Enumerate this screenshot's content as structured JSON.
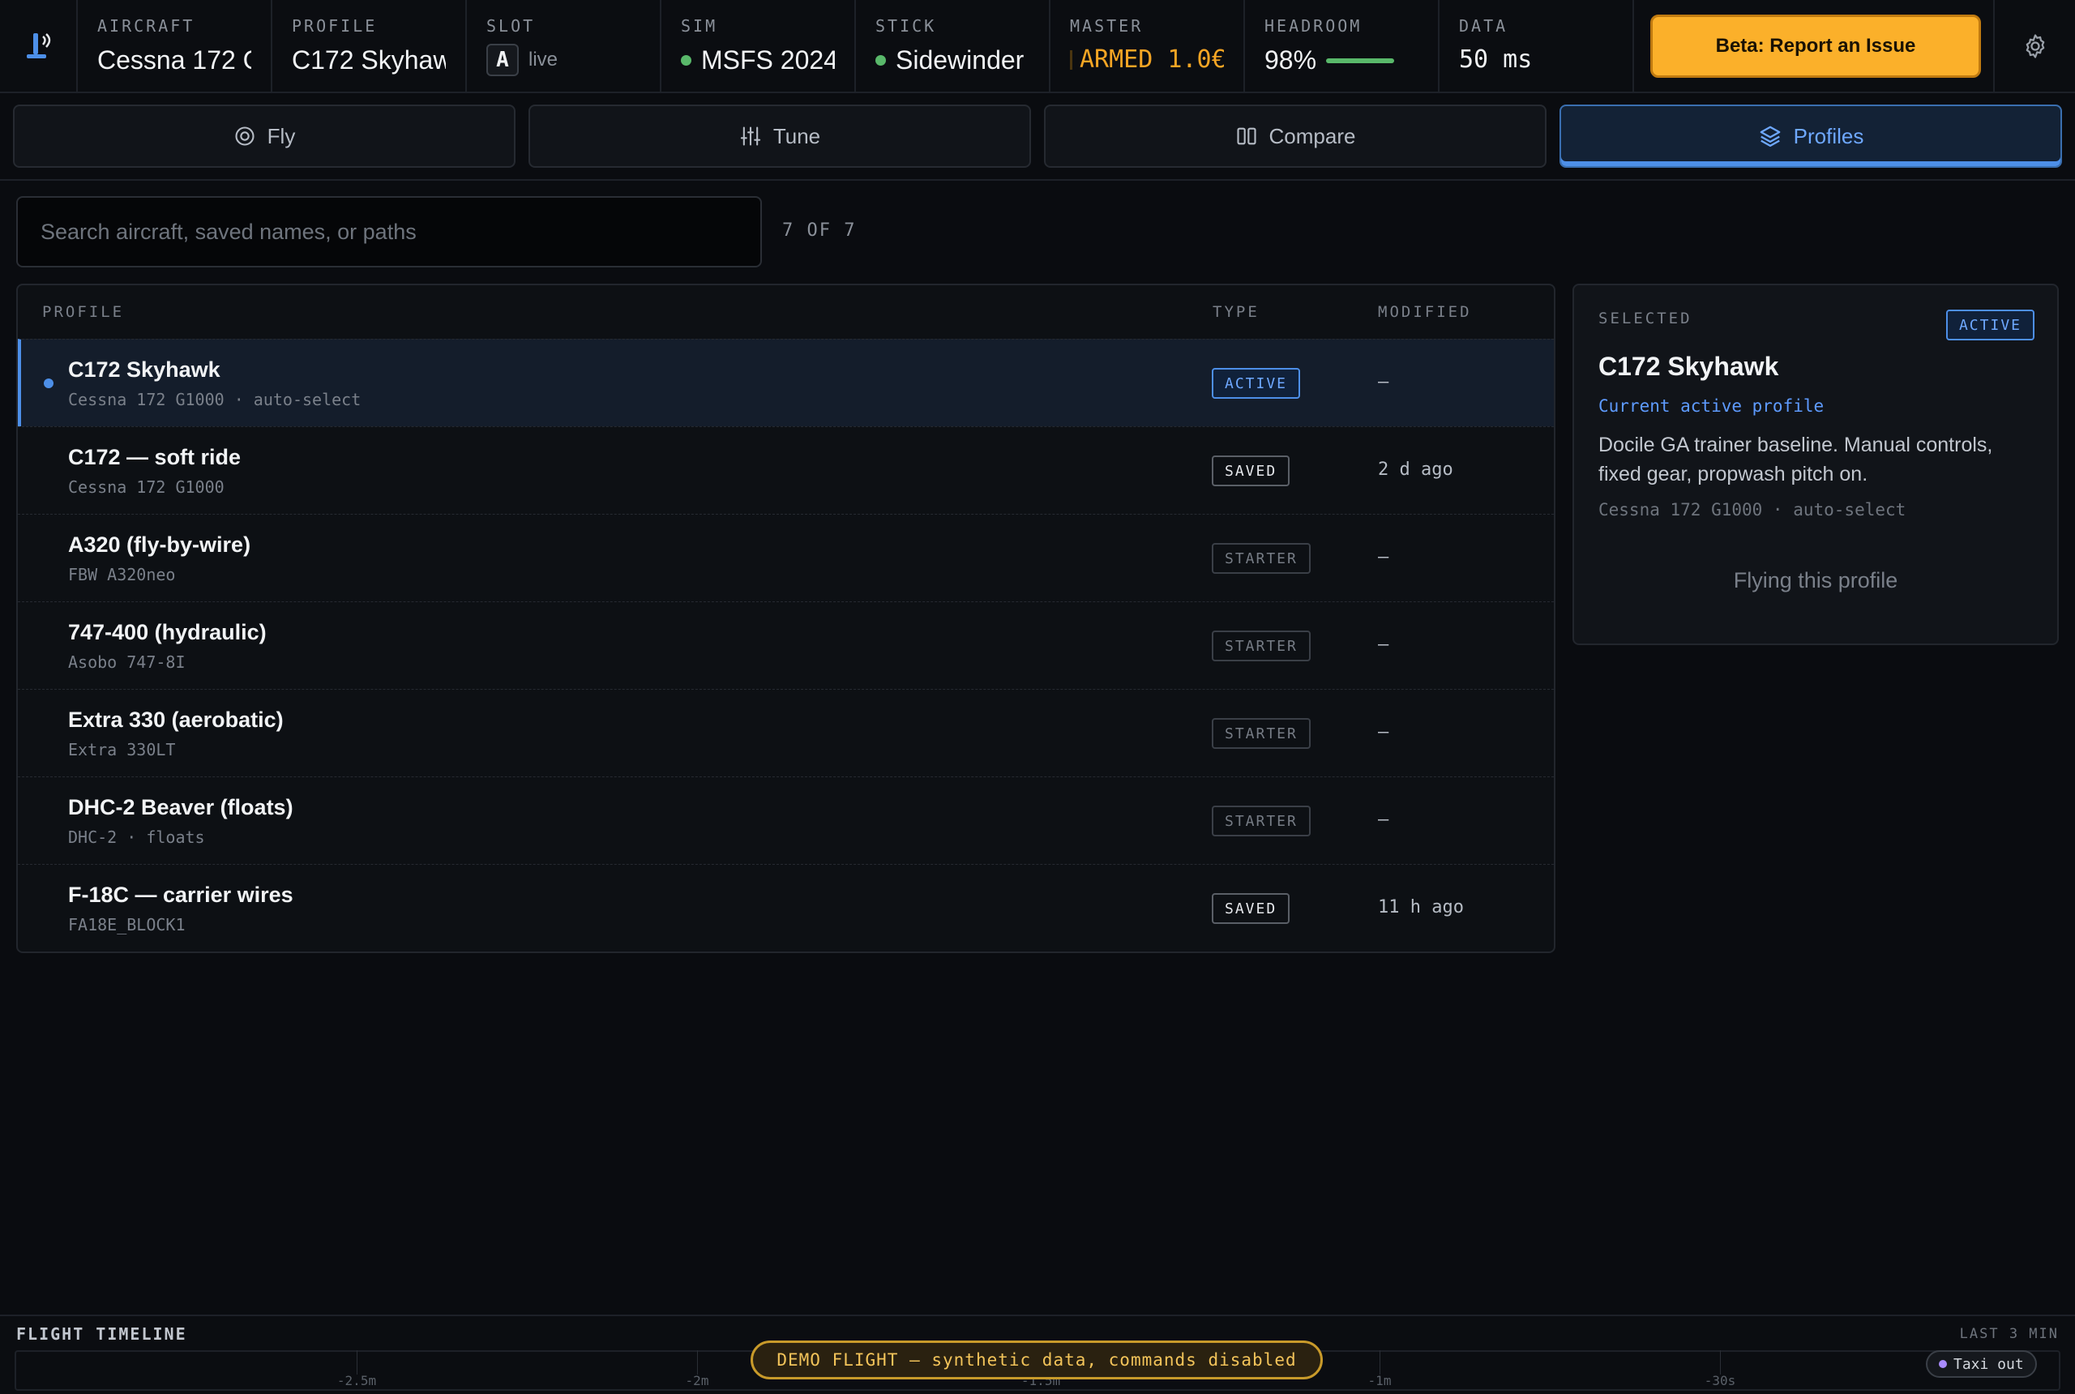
{
  "statusbar": {
    "aircraft": {
      "label": "AIRCRAFT",
      "value": "Cessna 172 G"
    },
    "profile": {
      "label": "PROFILE",
      "value": "C172 Skyhaw"
    },
    "slot": {
      "label": "SLOT",
      "value": "A",
      "state": "live"
    },
    "sim": {
      "label": "SIM",
      "value": "MSFS 2024",
      "status_color": "#59b86a"
    },
    "stick": {
      "label": "STICK",
      "value": "Sidewinder",
      "status_color": "#59b86a"
    },
    "master": {
      "label": "MASTER",
      "value": "ARMED 1.0€",
      "color": "#f5a524"
    },
    "headroom": {
      "label": "HEADROOM",
      "value": "98%",
      "level": 0.98
    },
    "data": {
      "label": "DATA",
      "value": "50 ms"
    },
    "report_button": "Beta: Report an Issue",
    "icons": {
      "logo": "app-logo-icon",
      "settings": "gear-icon"
    }
  },
  "tabs": [
    {
      "label": "Fly",
      "icon": "target-icon",
      "active": false
    },
    {
      "label": "Tune",
      "icon": "sliders-icon",
      "active": false
    },
    {
      "label": "Compare",
      "icon": "columns-icon",
      "active": false
    },
    {
      "label": "Profiles",
      "icon": "layers-icon",
      "active": true
    }
  ],
  "search": {
    "placeholder": "Search aircraft, saved names, or paths",
    "value": "",
    "count": "7 OF 7"
  },
  "table": {
    "headers": {
      "profile": "PROFILE",
      "type": "TYPE",
      "modified": "MODIFIED"
    },
    "rows": [
      {
        "name": "C172 Skyhawk",
        "sub": "Cessna 172 G1000 · auto-select",
        "type": "ACTIVE",
        "modified": "—",
        "selected": true
      },
      {
        "name": "C172 — soft ride",
        "sub": "Cessna 172 G1000",
        "type": "SAVED",
        "modified": "2 d ago",
        "selected": false
      },
      {
        "name": "A320 (fly-by-wire)",
        "sub": "FBW A320neo",
        "type": "STARTER",
        "modified": "—",
        "selected": false
      },
      {
        "name": "747-400 (hydraulic)",
        "sub": "Asobo 747-8I",
        "type": "STARTER",
        "modified": "—",
        "selected": false
      },
      {
        "name": "Extra 330 (aerobatic)",
        "sub": "Extra 330LT",
        "type": "STARTER",
        "modified": "—",
        "selected": false
      },
      {
        "name": "DHC-2 Beaver (floats)",
        "sub": "DHC-2 · floats",
        "type": "STARTER",
        "modified": "—",
        "selected": false
      },
      {
        "name": "F-18C — carrier wires",
        "sub": "FA18E_BLOCK1",
        "type": "SAVED",
        "modified": "11 h ago",
        "selected": false
      }
    ]
  },
  "selected_panel": {
    "label": "SELECTED",
    "badge": "ACTIVE",
    "title": "C172 Skyhawk",
    "status": "Current active profile",
    "description": "Docile GA trainer baseline. Manual controls, fixed gear, propwash pitch on.",
    "path": "Cessna 172 G1000 · auto-select",
    "cta": "Flying this profile"
  },
  "timeline": {
    "title": "FLIGHT TIMELINE",
    "range": "LAST 3 MIN",
    "ticks": [
      "-2.5m",
      "-2m",
      "-1.5m",
      "-1m",
      "-30s"
    ],
    "demo_banner": "DEMO FLIGHT — synthetic data, commands disabled",
    "phase": "Taxi out",
    "phase_color": "#a98bff"
  },
  "colors": {
    "accent": "#4d8fe8",
    "warning": "#fbb02a",
    "ok": "#59b86a"
  }
}
